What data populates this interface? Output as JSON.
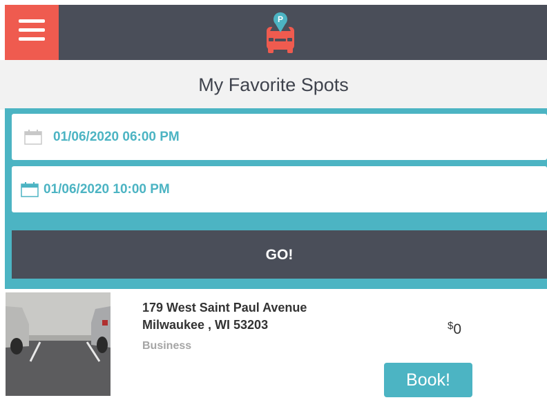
{
  "header": {
    "menu_icon": "hamburger-icon",
    "logo_icon": "parking-car-logo",
    "logo_letter": "P",
    "accent_color": "#ef5b4f",
    "bar_color": "#4a4e59"
  },
  "page_title": "My Favorite Spots",
  "search": {
    "start_datetime": "01/06/2020 06:00 PM",
    "end_datetime": "01/06/2020 10:00 PM",
    "calendar_icon": "calendar-icon",
    "go_label": "GO!",
    "panel_color": "#4cb4c3"
  },
  "results": [
    {
      "address_line1": "179 West Saint Paul Avenue",
      "address_line2": "Milwaukee , WI 53203",
      "category": "Business",
      "currency": "$",
      "price": "0",
      "book_label": "Book!"
    }
  ]
}
